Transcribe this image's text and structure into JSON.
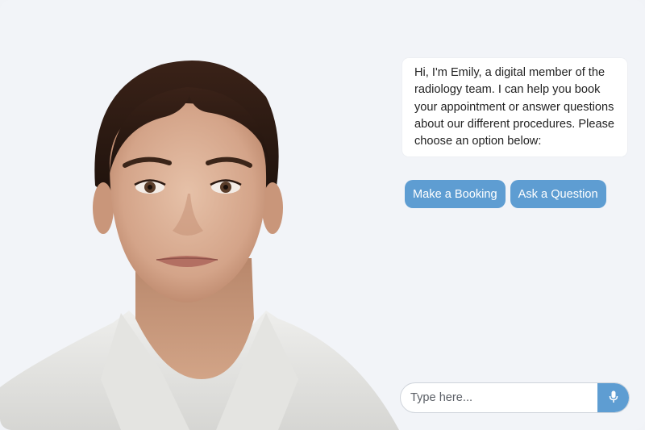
{
  "assistant": {
    "name": "Emily",
    "greeting": "Hi, I'm Emily, a digital member of the radiology team. I can help you book your appointment or answer questions about our different procedures. Please choose an option below:"
  },
  "options": [
    {
      "label": "Make a Booking"
    },
    {
      "label": "Ask a Question"
    }
  ],
  "composer": {
    "placeholder": "Type here...",
    "mic_icon": "microphone-icon"
  },
  "colors": {
    "accent": "#5e9dd2",
    "background": "#f2f4f8",
    "bubble": "#ffffff",
    "text": "#222222"
  }
}
